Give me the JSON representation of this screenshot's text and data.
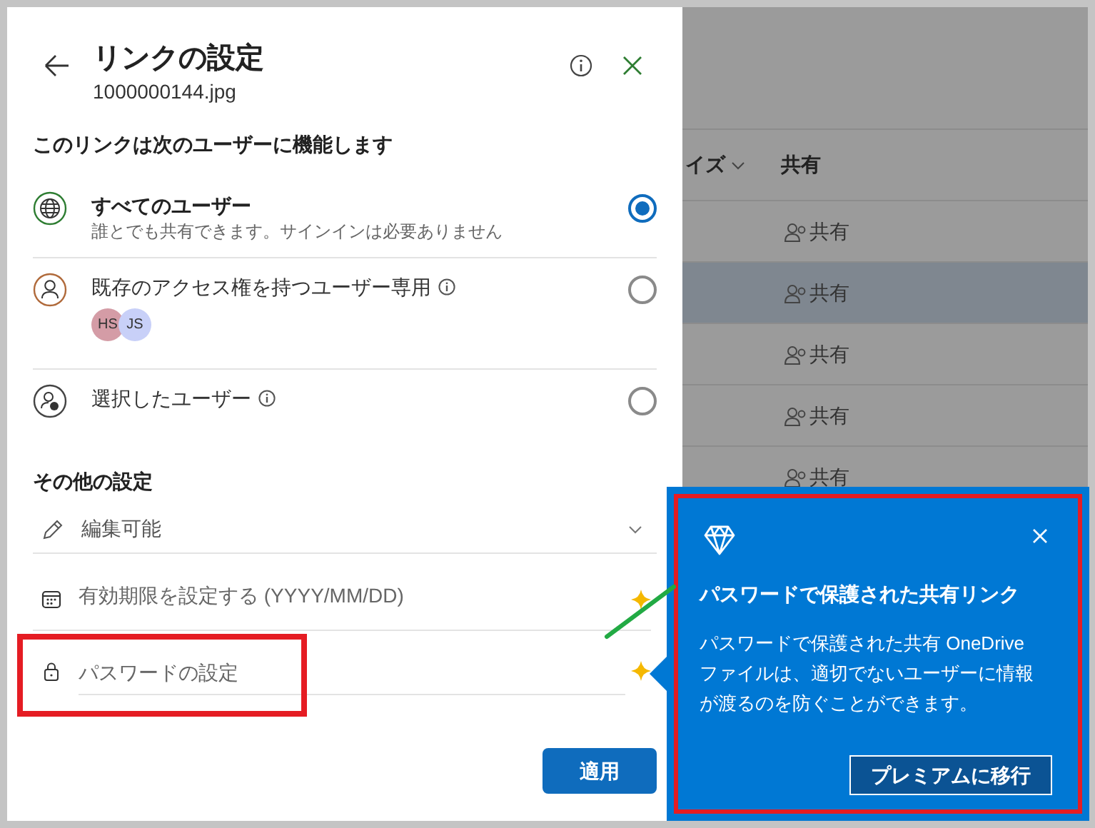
{
  "dialog": {
    "title": "リンクの設定",
    "file_name": "1000000144.jpg",
    "section_heading": "このリンクは次のユーザーに機能します",
    "options": [
      {
        "kind": "globe",
        "label": "すべてのユーザー",
        "description": "誰とでも共有できます。サインインは必要ありません",
        "info": false,
        "selected": true
      },
      {
        "kind": "person",
        "label": "既存のアクセス権を持つユーザー専用",
        "info": true,
        "avatars": [
          {
            "initials": "HS",
            "color": "#d49ca6"
          },
          {
            "initials": "JS",
            "color": "#c8d0f8"
          }
        ],
        "selected": false
      },
      {
        "kind": "people",
        "label": "選択したユーザー",
        "info": true,
        "selected": false
      }
    ],
    "other_heading": "その他の設定",
    "permission": "編集可能",
    "expiry": {
      "placeholder": "有効期限を設定する (YYYY/MM/DD)",
      "premium": true
    },
    "password": {
      "placeholder": "パスワードの設定",
      "premium": true
    },
    "apply_button": "適用"
  },
  "background": {
    "columns": [
      "イズ",
      "共有"
    ],
    "rows": [
      {
        "sharing": "共有",
        "selected": false
      },
      {
        "sharing": "共有",
        "selected": true
      },
      {
        "sharing": "共有",
        "selected": false
      },
      {
        "sharing": "共有",
        "selected": false
      },
      {
        "sharing": "共有",
        "selected": false
      }
    ]
  },
  "popover": {
    "title": "パスワードで保護された共有リンク",
    "body": "パスワードで保護された共有 OneDrive ファイルは、適切でないユーザーに情報が渡るのを防ぐことができます。",
    "button": "プレミアムに移行"
  }
}
